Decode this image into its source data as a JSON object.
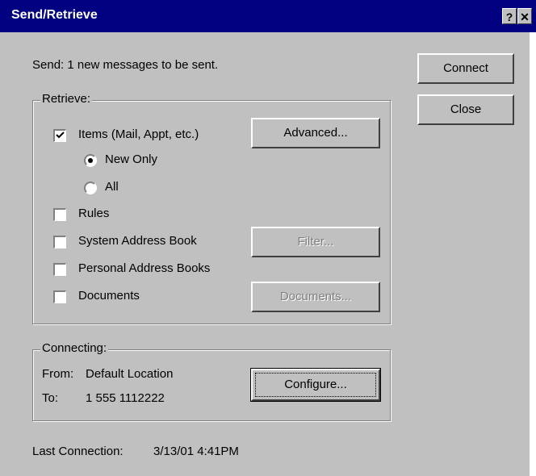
{
  "window": {
    "title": "Send/Retrieve",
    "help_glyph": "?",
    "close_glyph": "✕"
  },
  "send": {
    "status": "Send: 1 new messages to be sent."
  },
  "retrieve": {
    "legend": "Retrieve:",
    "items": {
      "label": "Items (Mail, Appt, etc.)",
      "checked": true
    },
    "new_only": {
      "label": "New Only",
      "selected": true
    },
    "all": {
      "label": "All",
      "selected": false
    },
    "rules": {
      "label": "Rules",
      "checked": false
    },
    "system_address_book": {
      "label": "System Address Book",
      "checked": false
    },
    "personal_address_books": {
      "label": "Personal Address Books",
      "checked": false
    },
    "documents": {
      "label": "Documents",
      "checked": false
    },
    "advanced_button": "Advanced...",
    "filter_button": "Filter...",
    "documents_button": "Documents..."
  },
  "connecting": {
    "legend": "Connecting:",
    "from_label": "From:",
    "from_value": "Default Location",
    "to_label": "To:",
    "to_value": "1 555 1112222",
    "configure_button": "Configure..."
  },
  "last_connection": {
    "label": "Last Connection:",
    "value": "3/13/01 4:41PM"
  },
  "buttons": {
    "connect": "Connect",
    "close": "Close"
  }
}
